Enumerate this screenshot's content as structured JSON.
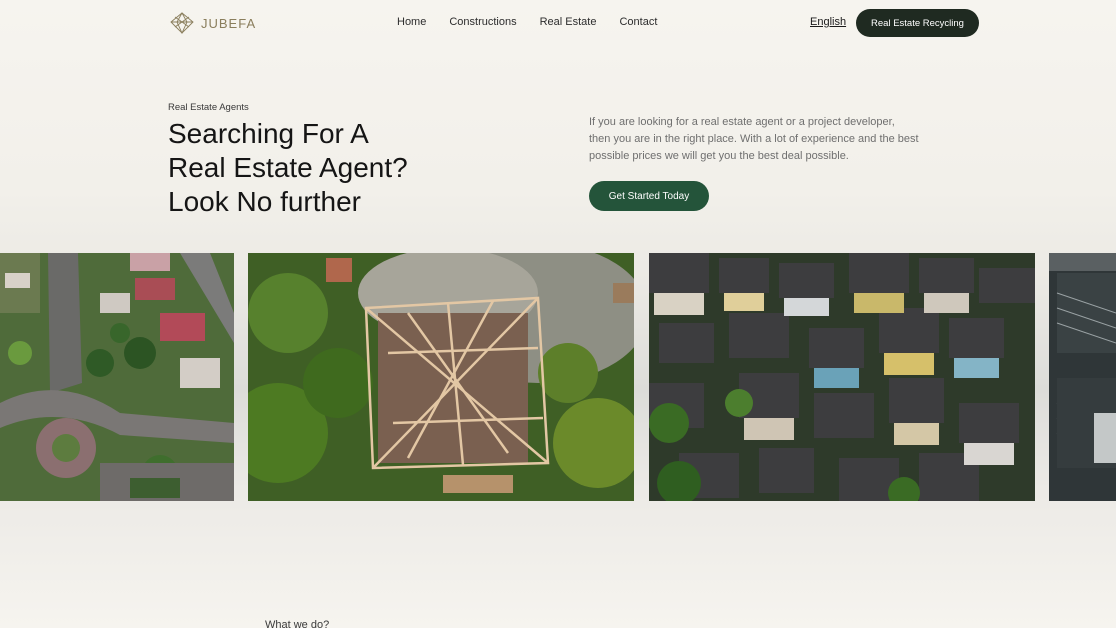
{
  "brand": {
    "name": "JUBEFA",
    "logo_icon": "diamond-lines-icon"
  },
  "nav": {
    "items": [
      {
        "label": "Home"
      },
      {
        "label": "Constructions"
      },
      {
        "label": "Real Estate"
      },
      {
        "label": "Contact"
      }
    ],
    "language": "English",
    "cta": "Real Estate Recycling"
  },
  "hero": {
    "eyebrow": "Real Estate Agents",
    "title_lines": [
      "Searching For A",
      "Real Estate Agent?",
      "Look No further"
    ],
    "description": "If you are looking for a real estate agent or a project developer, then you are in the right place. With a lot of experience and the best possible prices we will get you the best deal possible.",
    "cta": "Get Started Today"
  },
  "gallery": {
    "photos": [
      {
        "subject": "aerial-suburb-roundabout"
      },
      {
        "subject": "aerial-house-frame-construction"
      },
      {
        "subject": "aerial-dense-houses"
      },
      {
        "subject": "building-balconies"
      }
    ]
  },
  "next_section": {
    "label": "What we do?"
  },
  "colors": {
    "brand_text": "#8a7e5c",
    "dark_button": "#1f2a21",
    "green_button": "#24543a",
    "background": "#f6f4ef"
  }
}
